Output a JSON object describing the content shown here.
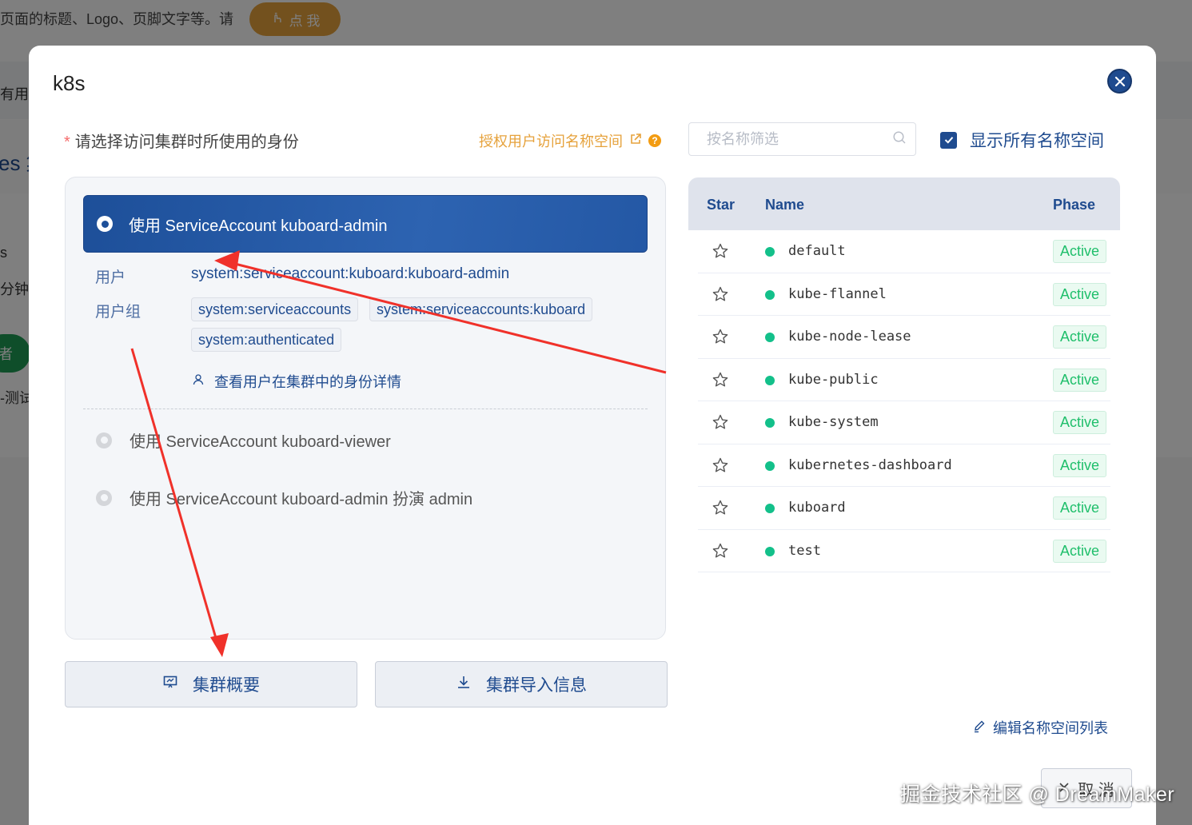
{
  "background": {
    "top_text": "页面的标题、Logo、页脚文字等。请",
    "top_button": "点 我",
    "fragments": [
      "有用",
      "es 集",
      "s",
      "分钟",
      "-测试"
    ],
    "green_text": "者"
  },
  "modal": {
    "title": "k8s",
    "identity_label": "请选择访问集群时所使用的身份",
    "auth_link": "授权用户访问名称空间",
    "help_mark": "?",
    "options": [
      {
        "label": "使用 ServiceAccount kuboard-admin",
        "selected": true
      },
      {
        "label": "使用 ServiceAccount kuboard-viewer",
        "selected": false
      },
      {
        "label": "使用 ServiceAccount kuboard-admin 扮演 admin",
        "selected": false
      }
    ],
    "details": {
      "user_key": "用户",
      "user_value": "system:serviceaccount:kuboard:kuboard-admin",
      "group_key": "用户组",
      "groups": [
        "system:serviceaccounts",
        "system:serviceaccounts:kuboard",
        "system:authenticated"
      ],
      "identity_detail_link": "查看用户在集群中的身份详情"
    },
    "buttons": {
      "overview": "集群概要",
      "import_info": "集群导入信息",
      "edit_namespaces": "编辑名称空间列表",
      "cancel": "取 消"
    },
    "filter": {
      "placeholder": "按名称筛选",
      "value": ""
    },
    "show_all_label": "显示所有名称空间",
    "show_all_checked": true,
    "table": {
      "headers": {
        "star": "Star",
        "name": "Name",
        "phase": "Phase"
      },
      "rows": [
        {
          "name": "default",
          "phase": "Active"
        },
        {
          "name": "kube-flannel",
          "phase": "Active"
        },
        {
          "name": "kube-node-lease",
          "phase": "Active"
        },
        {
          "name": "kube-public",
          "phase": "Active"
        },
        {
          "name": "kube-system",
          "phase": "Active"
        },
        {
          "name": "kubernetes-dashboard",
          "phase": "Active"
        },
        {
          "name": "kuboard",
          "phase": "Active"
        },
        {
          "name": "test",
          "phase": "Active"
        }
      ]
    }
  },
  "watermark": "掘金技术社区 @ DreamMaker",
  "colors": {
    "primary": "#1f4b8f",
    "warning": "#e6a23c",
    "success": "#1fbf6b",
    "annotation_arrow": "#f0312a"
  }
}
